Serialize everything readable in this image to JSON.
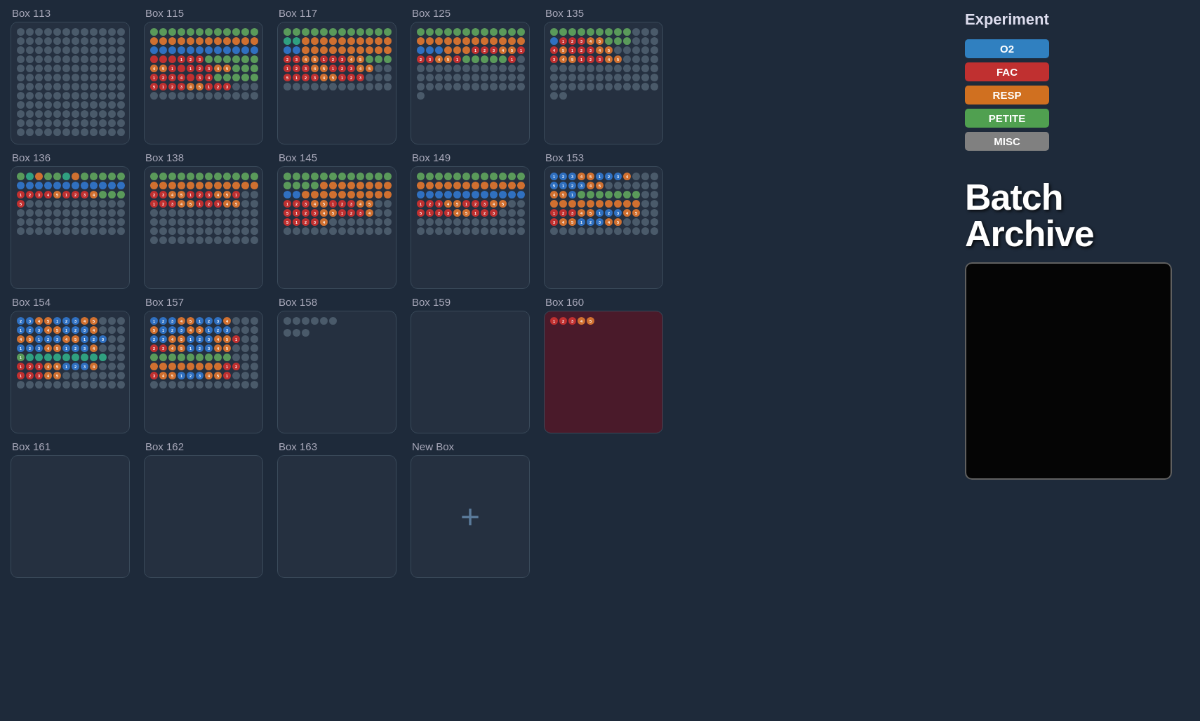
{
  "boxes": [
    {
      "id": "box-113",
      "label": "Box 113",
      "type": "filled",
      "variant": "multi"
    },
    {
      "id": "box-115",
      "label": "Box 115",
      "type": "filled",
      "variant": "multi"
    },
    {
      "id": "box-117",
      "label": "Box 117",
      "type": "filled",
      "variant": "multi"
    },
    {
      "id": "box-125",
      "label": "Box 125",
      "type": "filled",
      "variant": "multi"
    },
    {
      "id": "box-135",
      "label": "Box 135",
      "type": "filled",
      "variant": "partial"
    },
    {
      "id": "box-136",
      "label": "Box 136",
      "type": "filled",
      "variant": "multi"
    },
    {
      "id": "box-138",
      "label": "Box 138",
      "type": "filled",
      "variant": "multi"
    },
    {
      "id": "box-145",
      "label": "Box 145",
      "type": "filled",
      "variant": "multi"
    },
    {
      "id": "box-149",
      "label": "Box 149",
      "type": "filled",
      "variant": "multi"
    },
    {
      "id": "box-153",
      "label": "Box 153",
      "type": "filled",
      "variant": "multi"
    },
    {
      "id": "box-154",
      "label": "Box 154",
      "type": "filled",
      "variant": "blue-heavy"
    },
    {
      "id": "box-157",
      "label": "Box 157",
      "type": "filled",
      "variant": "multi"
    },
    {
      "id": "box-158",
      "label": "Box 158",
      "type": "sparse",
      "variant": "sparse"
    },
    {
      "id": "box-159",
      "label": "Box 159",
      "type": "empty",
      "variant": "empty"
    },
    {
      "id": "box-160",
      "label": "Box 160",
      "type": "maroon",
      "variant": "maroon"
    },
    {
      "id": "box-161",
      "label": "Box 161",
      "type": "empty",
      "variant": "empty"
    },
    {
      "id": "box-162",
      "label": "Box 162",
      "type": "empty",
      "variant": "empty"
    },
    {
      "id": "box-163",
      "label": "Box 163",
      "type": "empty",
      "variant": "empty"
    },
    {
      "id": "new-box",
      "label": "New Box",
      "type": "new",
      "variant": "new"
    }
  ],
  "experiment": {
    "title": "Experiment",
    "legend": [
      {
        "key": "o2",
        "label": "O2",
        "color": "#3080c0"
      },
      {
        "key": "fac",
        "label": "FAC",
        "color": "#c03030"
      },
      {
        "key": "resp",
        "label": "RESP",
        "color": "#d07020"
      },
      {
        "key": "petite",
        "label": "PETITE",
        "color": "#50a050"
      },
      {
        "key": "misc",
        "label": "MISC",
        "color": "#808080"
      }
    ]
  },
  "batch_archive": {
    "title": "Batch Archive"
  },
  "new_box_plus": "+"
}
